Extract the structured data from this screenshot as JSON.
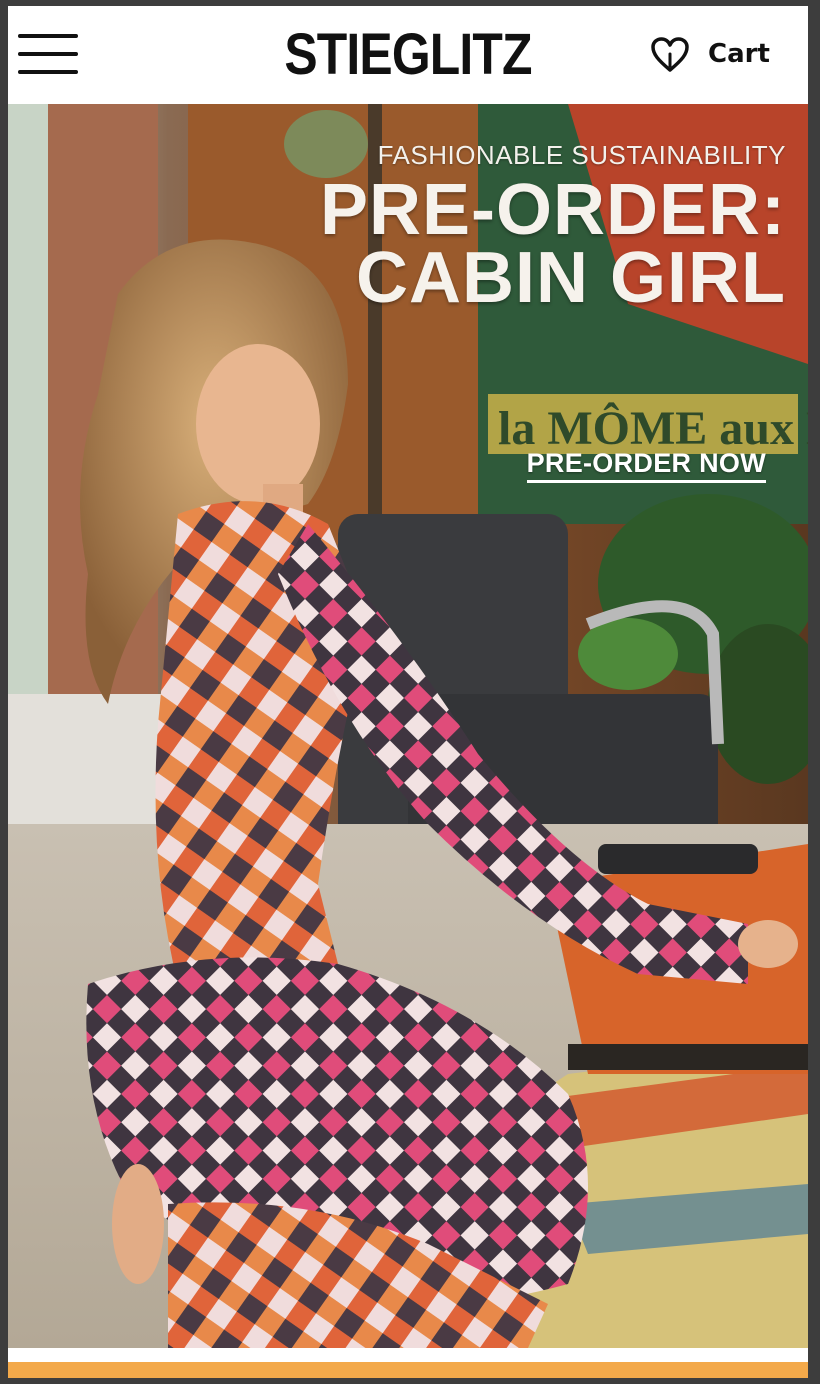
{
  "header": {
    "menu_icon": "hamburger-menu-icon",
    "logo": "STIEGLITZ",
    "wishlist_icon": "heart-icon",
    "cart_label": "Cart"
  },
  "hero": {
    "eyebrow": "FASHIONABLE SUSTAINABILITY",
    "headline_line1": "PRE-ORDER:",
    "headline_line2": "CABIN GIRL",
    "cta_label": "PRE-ORDER NOW",
    "poster_text": "la MÔME aux D"
  },
  "colors": {
    "accent_strip": "#f3a94a",
    "text_dark": "#111111",
    "hero_text": "#f6f2ec"
  }
}
